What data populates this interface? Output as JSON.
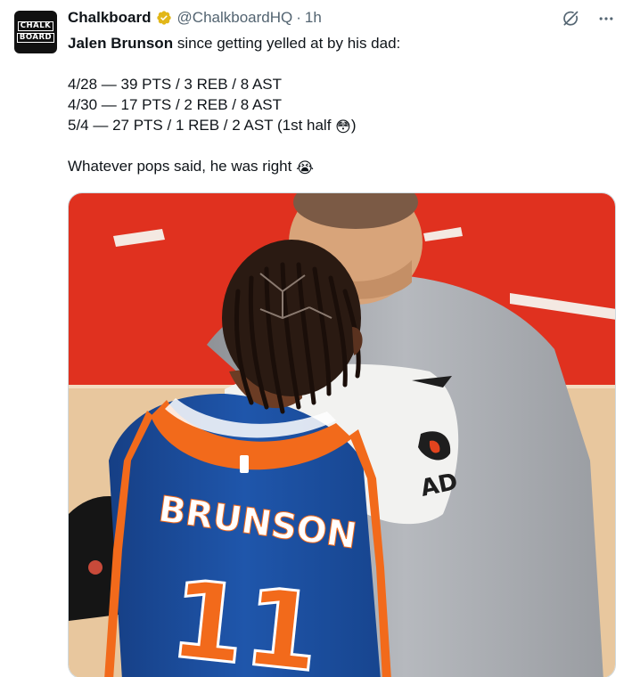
{
  "author": {
    "display_name": "Chalkboard",
    "handle": "@ChalkboardHQ",
    "separator": "·",
    "time": "1h",
    "avatar_text": [
      "CHALK",
      "BOARD"
    ],
    "verified_icon": "verified-gold-badge-icon"
  },
  "actions": {
    "grok_icon": "grok-icon",
    "more_icon": "more-icon"
  },
  "tweet": {
    "line1_strong": "Jalen Brunson",
    "line1_rest": " since getting yelled at by his dad:",
    "stats": [
      "4/28 — 39 PTS / 3 REB / 8 AST",
      "4/30 — 17 PTS / 2 REB / 8 AST",
      "5/4 — 27 PTS / 1 REB / 2 AST (1st half "
    ],
    "stats_tail_emoji": "😳",
    "stats_tail_close": ")",
    "closing": "Whatever pops said, he was right ",
    "closing_emoji": "😭"
  },
  "media": {
    "jersey_name": "BRUNSON",
    "jersey_number": "11",
    "towel_text": "AD",
    "colors": {
      "court_red": "#e0311f",
      "court_wood": "#e8c79e",
      "jersey_blue": "#1d4fa0",
      "jersey_orange": "#f26a1b",
      "shirt_gray": "#a9acb1"
    }
  }
}
